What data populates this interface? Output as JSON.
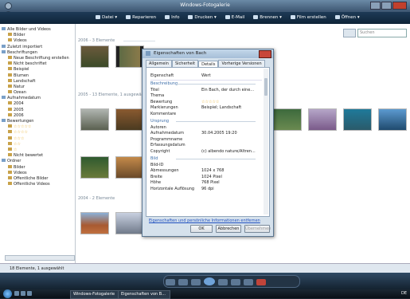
{
  "window": {
    "title": "Windows-Fotogalerie"
  },
  "toolbar": {
    "items": [
      "Datei",
      "Reparieren",
      "Info",
      "Drucken",
      "E-Mail",
      "Brennen",
      "Film erstellen",
      "Öffnen"
    ]
  },
  "search": {
    "placeholder": "Suchen"
  },
  "nav": {
    "items": [
      {
        "label": "Alle Bilder und Videos",
        "level": 0
      },
      {
        "label": "Bilder",
        "level": 1
      },
      {
        "label": "Videos",
        "level": 1
      },
      {
        "label": "Zuletzt importiert",
        "level": 0
      },
      {
        "label": "Beschriftungen",
        "level": 0
      },
      {
        "label": "Neue Beschriftung erstellen",
        "level": 1
      },
      {
        "label": "Nicht beschriftet",
        "level": 1
      },
      {
        "label": "Beispiel",
        "level": 1
      },
      {
        "label": "Blumen",
        "level": 1
      },
      {
        "label": "Landschaft",
        "level": 1
      },
      {
        "label": "Natur",
        "level": 1
      },
      {
        "label": "Ozean",
        "level": 1
      },
      {
        "label": "Aufnahmedatum",
        "level": 0
      },
      {
        "label": "2004",
        "level": 1
      },
      {
        "label": "2005",
        "level": 1
      },
      {
        "label": "2006",
        "level": 1
      },
      {
        "label": "Bewertungen",
        "level": 0
      },
      {
        "label": "☆☆☆☆☆",
        "level": 1
      },
      {
        "label": "☆☆☆☆",
        "level": 1
      },
      {
        "label": "☆☆☆",
        "level": 1
      },
      {
        "label": "☆☆",
        "level": 1
      },
      {
        "label": "☆",
        "level": 1
      },
      {
        "label": "Nicht bewertet",
        "level": 1
      },
      {
        "label": "Ordner",
        "level": 0
      },
      {
        "label": "Bilder",
        "level": 1
      },
      {
        "label": "Videos",
        "level": 1
      },
      {
        "label": "Öffentliche Bilder",
        "level": 1
      },
      {
        "label": "Öffentliche Videos",
        "level": 1
      }
    ]
  },
  "groups": [
    {
      "label": "2006 - 3 Elemente"
    },
    {
      "label": "2005 - 13 Elemente, 1 ausgewählt"
    },
    {
      "label": "2004 - 2 Elemente"
    }
  ],
  "status": {
    "text": "18 Elemente, 1 ausgewählt"
  },
  "dialog": {
    "title": "Eigenschaften von Bach",
    "tabs": [
      "Allgemein",
      "Sicherheit",
      "Details",
      "Vorherige Versionen"
    ],
    "active_tab": "Details",
    "header": {
      "prop": "Eigenschaft",
      "value": "Wert"
    },
    "sections": {
      "desc": "Beschreibung",
      "origin": "Ursprung",
      "image": "Bild"
    },
    "rows_desc": [
      {
        "k": "Titel",
        "v": "Ein Bach, der durch eine..."
      },
      {
        "k": "Thema",
        "v": ""
      },
      {
        "k": "Bewertung",
        "v": "☆☆☆☆☆"
      },
      {
        "k": "Markierungen",
        "v": "Beispiel; Landschaft"
      },
      {
        "k": "Kommentare",
        "v": ""
      }
    ],
    "rows_origin": [
      {
        "k": "Autoren",
        "v": ""
      },
      {
        "k": "Aufnahmedatum",
        "v": "30.04.2005 19:20"
      },
      {
        "k": "Programmname",
        "v": ""
      },
      {
        "k": "Erfassungsdatum",
        "v": ""
      },
      {
        "k": "Copyright",
        "v": "(c) albendo nature/Altren..."
      }
    ],
    "rows_image": [
      {
        "k": "Bild-ID",
        "v": ""
      },
      {
        "k": "Abmessungen",
        "v": "1024 x 768"
      },
      {
        "k": "Breite",
        "v": "1024 Pixel"
      },
      {
        "k": "Höhe",
        "v": "768 Pixel"
      },
      {
        "k": "Horizontale Auflösung",
        "v": "96 dpi"
      }
    ],
    "link": "Eigenschaften und persönliche Informationen entfernen",
    "ok": "OK",
    "cancel": "Abbrechen",
    "apply": "Übernehmen"
  },
  "taskbar": {
    "items": [
      "Windows-Fotogalerie",
      "Eigenschaften von B..."
    ],
    "clock": "DE"
  },
  "colors": {
    "accent": "#3a6ca8",
    "toolbar": "#1e3a56"
  }
}
